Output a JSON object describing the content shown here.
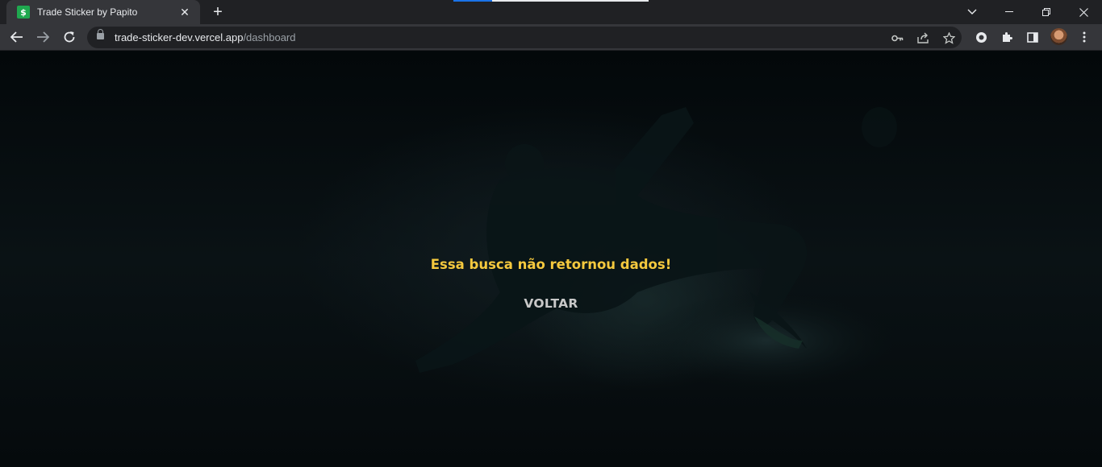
{
  "browser": {
    "tab": {
      "title": "Trade Sticker by Papito",
      "favicon": "$",
      "close_icon": "close-icon"
    },
    "new_tab_icon": "plus-icon",
    "window_controls": [
      "chevron-down-icon",
      "minimize-icon",
      "restore-icon",
      "close-icon"
    ],
    "address": {
      "host": "trade-sticker-dev.vercel.app",
      "path": "/dashboard"
    },
    "toolbar_icons": [
      "back-icon",
      "forward-icon",
      "reload-icon",
      "lock-icon",
      "key-icon",
      "share-icon",
      "star-icon",
      "extension-icon",
      "puzzle-icon",
      "sidepanel-icon",
      "avatar",
      "menu-icon"
    ]
  },
  "page": {
    "message": "Essa busca não retornou dados!",
    "back_label": "VOLTAR"
  },
  "colors": {
    "background": "#050a0c",
    "message": "#f5c93e",
    "button_text": "#c8c8c8"
  }
}
